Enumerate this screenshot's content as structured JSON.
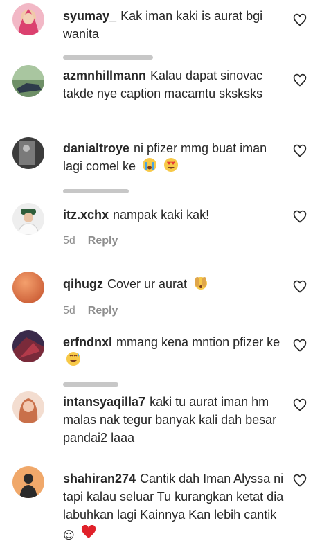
{
  "comments": [
    {
      "user": "syumay_",
      "text": "Kak iman kaki is aurat bgi wanita",
      "avatar_color": "#d93a6a"
    },
    {
      "user": "azmnhillmann",
      "text": "Kalau dapat sinovac takde nye caption macamtu sksksks",
      "avatar_color": "#5d6f7d"
    },
    {
      "user": "danialtroye",
      "text": "ni pfizer mmg buat iman lagi comel ke",
      "emojis": [
        "crying-face-emoji",
        "heart-eyes-emoji"
      ],
      "avatar_color": "#5a5a5a"
    },
    {
      "user": "itz.xchx",
      "text": "nampak kaki kak!",
      "time": "5d",
      "reply": "Reply",
      "avatar_color": "#2f5d3a"
    },
    {
      "user": "qihugz",
      "text": "Cover ur aurat",
      "emojis": [
        "covering-face-emoji"
      ],
      "time": "5d",
      "reply": "Reply",
      "avatar_color": "#e07a4a"
    },
    {
      "user": "erfndnxl",
      "text": "mmang kena mntion pfizer ke",
      "emojis": [
        "grinning-sweat-emoji"
      ],
      "avatar_color": "#7a2a3a"
    },
    {
      "user": "intansyaqilla7",
      "text": "kaki tu aurat iman hm malas nak tegur banyak kali dah besar pandai2 laaa",
      "avatar_color": "#e8b9a0"
    },
    {
      "user": "shahiran274",
      "text": "Cantik dah Iman Alyssa ni tapi kalau seluar Tu kurangkan ketat dia labuhkan lagi Kainnya Kan lebih cantik",
      "emojis": [
        "smiling-face-glyph",
        "red-heart-emoji"
      ],
      "avatar_color": "#c86a3a"
    }
  ],
  "colors": {
    "text": "#262626",
    "meta": "#8e8e8e",
    "heart": "#262626"
  },
  "icons": {
    "like": "heart-outline-icon"
  }
}
